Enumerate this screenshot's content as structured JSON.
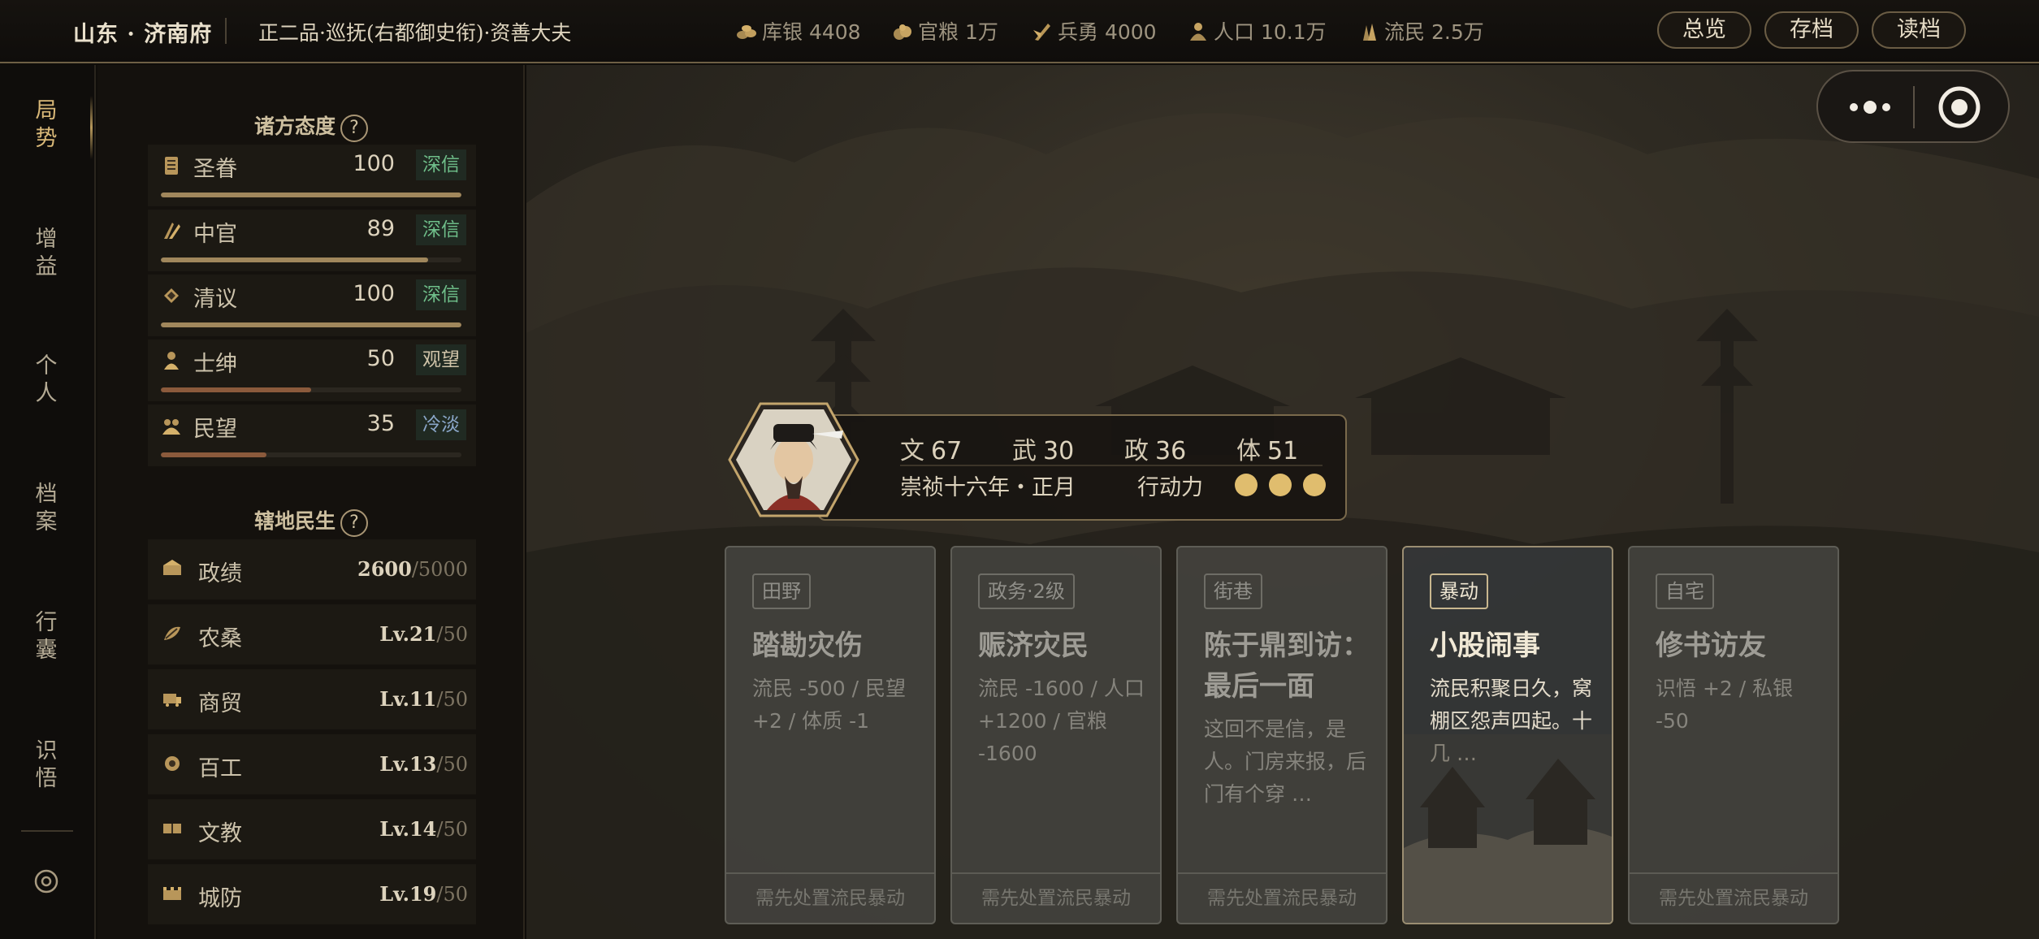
{
  "header": {
    "location": "山东 · 济南府",
    "rank": "正二品·巡抚(右都御史衔)·资善大夫",
    "resources": [
      {
        "icon": "silver-icon",
        "label": "库银",
        "value": "4408"
      },
      {
        "icon": "grain-icon",
        "label": "官粮",
        "value": "1万"
      },
      {
        "icon": "soldier-icon",
        "label": "兵勇",
        "value": "4000"
      },
      {
        "icon": "population-icon",
        "label": "人口",
        "value": "10.1万"
      },
      {
        "icon": "refugee-icon",
        "label": "流民",
        "value": "2.5万"
      }
    ],
    "buttons": {
      "overview": "总览",
      "save": "存档",
      "load": "读档"
    }
  },
  "nav": {
    "items": [
      {
        "label": "局\n势"
      },
      {
        "label": "增\n益"
      },
      {
        "label": "个\n人"
      },
      {
        "label": "档\n案"
      },
      {
        "label": "行\n囊"
      },
      {
        "label": "识\n悟"
      }
    ],
    "settings_icon": "gear-icon"
  },
  "attitudes": {
    "title": "诸方态度",
    "help": "?",
    "items": [
      {
        "icon": "edict-icon",
        "name": "圣眷",
        "value": "100",
        "status": "深信",
        "level": 1.0,
        "status_color": "#6fbf8a",
        "bar_color": "#a0875c"
      },
      {
        "icon": "eunuch-icon",
        "name": "中官",
        "value": "89",
        "status": "深信",
        "level": 0.89,
        "status_color": "#6fbf8a",
        "bar_color": "#a0875c"
      },
      {
        "icon": "scholar-icon",
        "name": "清议",
        "value": "100",
        "status": "深信",
        "level": 1.0,
        "status_color": "#6fbf8a",
        "bar_color": "#a0875c"
      },
      {
        "icon": "gentry-icon",
        "name": "士绅",
        "value": "50",
        "status": "观望",
        "level": 0.5,
        "status_color": "#cfc3a8",
        "bar_color": "#8b5a3c"
      },
      {
        "icon": "people-icon",
        "name": "民望",
        "value": "35",
        "status": "冷淡",
        "level": 0.35,
        "status_color": "#8aa6c8",
        "bar_color": "#8b5a3c"
      }
    ]
  },
  "livelihood": {
    "title": "辖地民生",
    "help": "?",
    "items": [
      {
        "icon": "merit-icon",
        "name": "政绩",
        "current": "2600",
        "max": "/5000"
      },
      {
        "icon": "farm-icon",
        "name": "农桑",
        "current": "Lv.21",
        "max": "/50"
      },
      {
        "icon": "trade-icon",
        "name": "商贸",
        "current": "Lv.11",
        "max": "/50"
      },
      {
        "icon": "craft-icon",
        "name": "百工",
        "current": "Lv.13",
        "max": "/50"
      },
      {
        "icon": "education-icon",
        "name": "文教",
        "current": "Lv.14",
        "max": "/50"
      },
      {
        "icon": "defense-icon",
        "name": "城防",
        "current": "Lv.19",
        "max": "/50"
      }
    ]
  },
  "character": {
    "stats": [
      {
        "label": "文",
        "value": "67"
      },
      {
        "label": "武",
        "value": "30"
      },
      {
        "label": "政",
        "value": "36"
      },
      {
        "label": "体",
        "value": "51"
      }
    ],
    "date": "崇祯十六年・正月",
    "action_label": "行动力",
    "action_points": 3
  },
  "cards": [
    {
      "tag": "田野",
      "title": "踏勘灾伤",
      "desc": "流民 -500 / 民望 +2 / 体质 -1",
      "footer": "需先处置流民暴动",
      "active": false
    },
    {
      "tag": "政务·2级",
      "title": "赈济灾民",
      "desc": "流民 -1600 / 人口 +1200 / 官粮 -1600",
      "footer": "需先处置流民暴动",
      "active": false
    },
    {
      "tag": "街巷",
      "title": "陈于鼎到访：最后一面",
      "desc": "这回不是信，是人。门房来报，后门有个穿 …",
      "footer": "需先处置流民暴动",
      "active": false
    },
    {
      "tag": "暴动",
      "title": "小股闹事",
      "desc": "流民积聚日久，窝棚区怨声四起。十几 …",
      "footer": "",
      "active": true
    },
    {
      "tag": "自宅",
      "title": "修书访友",
      "desc": "识悟 +2 / 私银 -50",
      "footer": "需先处置流民暴动",
      "active": false
    }
  ]
}
